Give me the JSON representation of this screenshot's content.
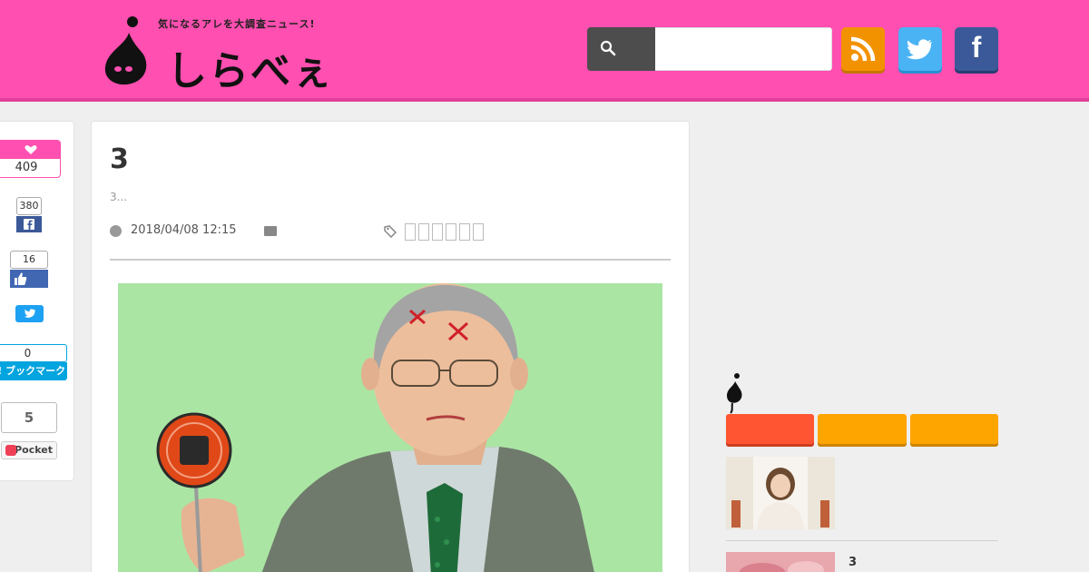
{
  "site": {
    "tagline": "気になるアレを大調査ニュース!",
    "logo_text": "しらべぇ"
  },
  "search": {
    "placeholder": "",
    "value": ""
  },
  "social": {
    "rss": "rss-feed",
    "twitter": "twitter",
    "facebook_letter": "f"
  },
  "share": {
    "like_count": "409",
    "fb_share_count": "380",
    "fb_like_count": "16",
    "hatena_count": "0",
    "hatena_label": "B! ブックマーク",
    "pocket_count": "5",
    "pocket_label": "Pocket"
  },
  "article": {
    "title": "3",
    "excerpt": "3...",
    "date": "2018/04/08 12:15"
  },
  "sidebar": {
    "items": [
      {
        "title": ""
      },
      {
        "title": "3"
      }
    ]
  },
  "colors": {
    "header": "#ff4fb0",
    "tab_red": "#ff5533",
    "tab_orange": "#ffa500",
    "rss": "#f39200",
    "twitter": "#4ab3f4",
    "facebook": "#3b5998"
  }
}
